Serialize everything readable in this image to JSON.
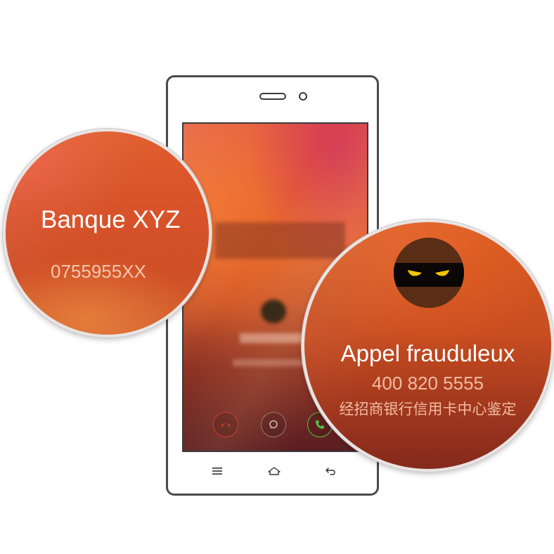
{
  "left_lens": {
    "caller_name": "Banque XYZ",
    "caller_number": "0755955XX"
  },
  "right_lens": {
    "avatar_icon": "masked-ninja-icon",
    "warning_title": "Appel frauduleux",
    "caller_number": "400 820 5555",
    "caller_description": "经招商银行信用卡中心鉴定"
  },
  "call_actions": {
    "reject_icon": "phone-hangup-icon",
    "message_icon": "message-bubble-icon",
    "accept_icon": "phone-answer-icon"
  },
  "navbar": {
    "menu_icon": "menu-icon",
    "home_icon": "home-icon",
    "back_icon": "back-arrow-icon"
  },
  "colors": {
    "reject": "#d23a2c",
    "accept": "#4ec34a",
    "accent_orange": "#d8522a",
    "eye_yellow": "#f5c400"
  }
}
